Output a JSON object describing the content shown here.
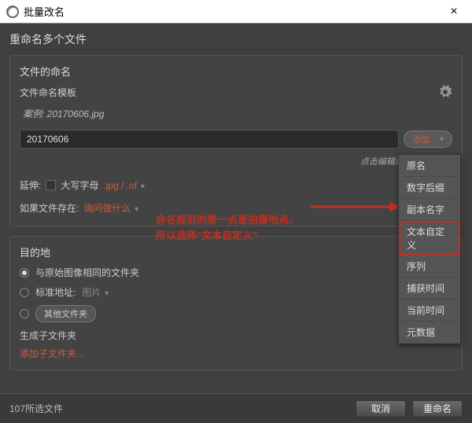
{
  "titlebar": {
    "title": "批量改名",
    "close": "×"
  },
  "header": "重命名多个文件",
  "naming": {
    "title": "文件的命名",
    "template_label": "文件命名模板",
    "example": "案例: 20170606.jpg",
    "input_value": "20170606",
    "add_btn": "添加…",
    "hint": "点击编辑或删除,拖放…",
    "ext_label": "延伸:",
    "uppercase_label": "大写字母",
    "ext_value": ".jpg / .of",
    "exists_label": "如果文件存在:",
    "exists_action": "询问做什么"
  },
  "dest": {
    "title": "目的地",
    "opt_same": "与原始图像相同的文件夹",
    "opt_std_label": "标准地址:",
    "opt_std_value": "图片",
    "opt_other": "其他文件夹",
    "gen_label": "生成子文件夹",
    "add_sub": "添加子文件夹…"
  },
  "footer": {
    "status": "107所选文件",
    "cancel": "取消",
    "rename": "重命名"
  },
  "menu": {
    "items": [
      "原名",
      "数字后缀",
      "副本名字",
      "文本自定义",
      "序列",
      "捕获时间",
      "当前时间",
      "元数据"
    ],
    "highlight_index": 3
  },
  "annotation": {
    "line1": "命名规则的第一点是拍摄地点。",
    "line2": "所以选择\"文本自定义\""
  }
}
